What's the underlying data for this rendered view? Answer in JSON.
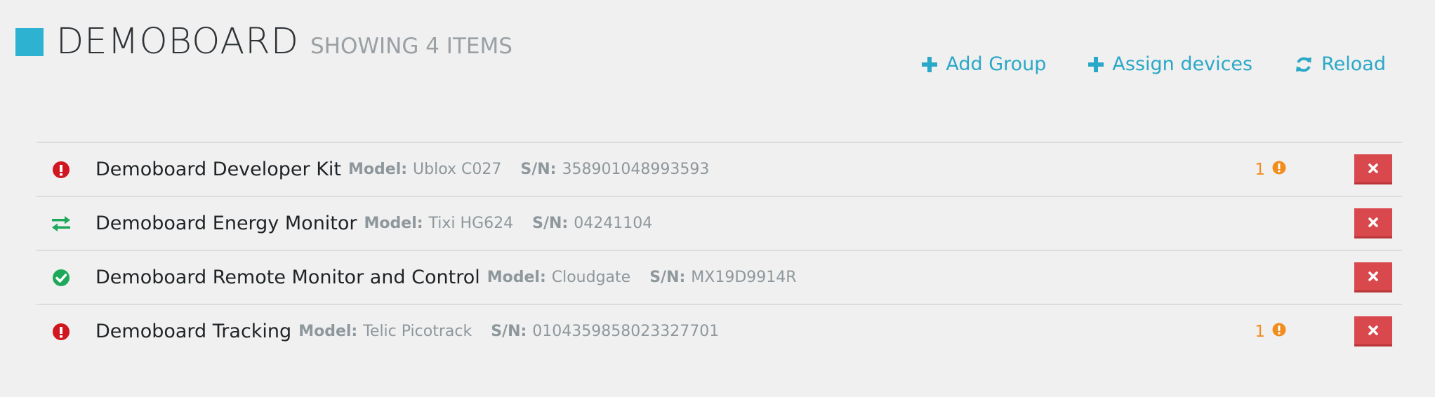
{
  "header": {
    "title": "DEMOBOARD",
    "count_text": "SHOWING 4 ITEMS",
    "accent_color": "#2db3d1"
  },
  "toolbar": {
    "add_group": {
      "label": "Add Group",
      "icon": "plus-icon"
    },
    "assign_devices": {
      "label": "Assign devices",
      "icon": "plus-icon"
    },
    "reload": {
      "label": "Reload",
      "icon": "refresh-icon"
    },
    "color": "#2aa8c7"
  },
  "labels": {
    "model": "Model:",
    "sn": "S/N:"
  },
  "devices": [
    {
      "name": "Demoboard Developer Kit",
      "model": "Ublox C027",
      "sn": "358901048993593",
      "status": "error",
      "status_icon": "exclamation-circle-icon",
      "alerts": "1"
    },
    {
      "name": "Demoboard Energy Monitor",
      "model": "Tixi HG624",
      "sn": "04241104",
      "status": "transfer",
      "status_icon": "exchange-arrows-icon",
      "alerts": ""
    },
    {
      "name": "Demoboard Remote Monitor and Control",
      "model": "Cloudgate",
      "sn": "MX19D9914R",
      "status": "ok",
      "status_icon": "check-circle-icon",
      "alerts": ""
    },
    {
      "name": "Demoboard Tracking",
      "model": "Telic Picotrack",
      "sn": "0104359858023327701",
      "status": "error",
      "status_icon": "exclamation-circle-icon",
      "alerts": "1"
    }
  ],
  "colors": {
    "error": "#d0161f",
    "ok": "#1ea95a",
    "transfer": "#1ea95a",
    "alert": "#f28c1c",
    "delete": "#d9484c"
  }
}
